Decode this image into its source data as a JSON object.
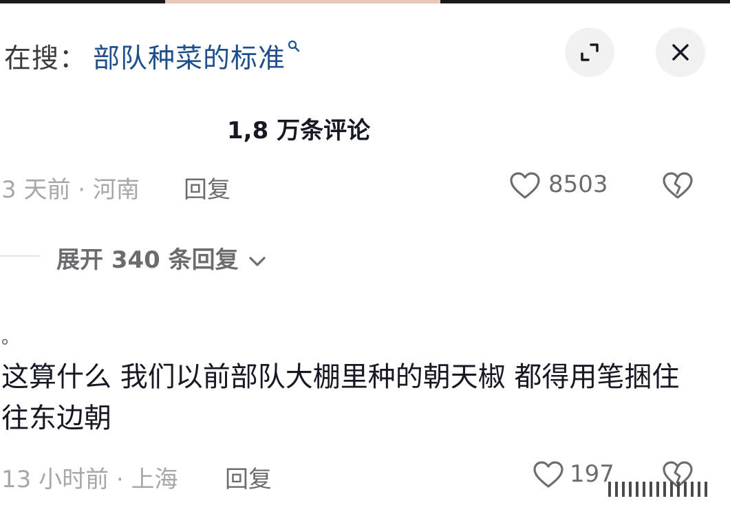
{
  "search": {
    "prefix": "在搜：",
    "query": "部队种菜的标准"
  },
  "icons": {
    "search": "search-icon",
    "expand": "expand-icon",
    "close": "close-icon",
    "like": "heart-icon",
    "dislike": "broken-heart-icon",
    "chevron": "chevron-down-icon"
  },
  "comments_header": {
    "count_label": "1,8 万条评论"
  },
  "comment1": {
    "meta": "3 天前 · 河南",
    "reply_label": "回复",
    "likes": "8503",
    "expand_label": "展开 340 条回复"
  },
  "comment2": {
    "dot": "。",
    "text": "这算什么 我们以前部队大棚里种的朝天椒 都得用笔捆住往东边朝",
    "meta": "13 小时前 · 上海",
    "reply_label": "回复",
    "likes": "197"
  },
  "colors": {
    "query": "#1e4f8c",
    "meta": "#a6a7ab",
    "action": "#6b6c70",
    "text": "#161823"
  }
}
